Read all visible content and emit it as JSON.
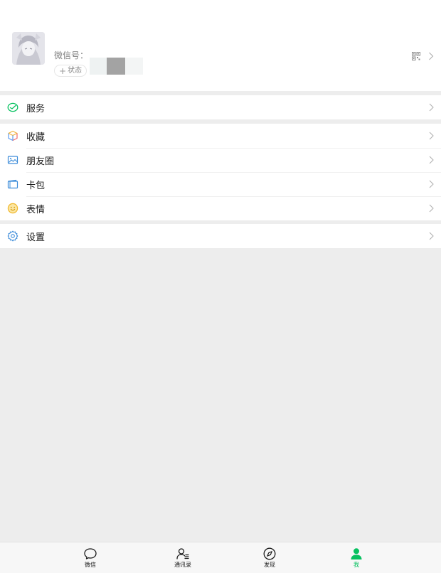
{
  "profile": {
    "wxid_label": "微信号：",
    "status_label": "状态",
    "status_plus": "+"
  },
  "menu": {
    "services": {
      "label": "服务",
      "icon": "services-icon"
    },
    "favorites": {
      "label": "收藏",
      "icon": "favorites-icon"
    },
    "moments": {
      "label": "朋友圈",
      "icon": "moments-icon"
    },
    "cards": {
      "label": "卡包",
      "icon": "card-wallet-icon"
    },
    "stickers": {
      "label": "表情",
      "icon": "sticker-icon"
    },
    "settings": {
      "label": "设置",
      "icon": "settings-icon"
    }
  },
  "tabs": [
    {
      "label": "微信",
      "icon": "chat-bubble-icon",
      "active": false
    },
    {
      "label": "通讯录",
      "icon": "contacts-icon",
      "active": false
    },
    {
      "label": "发现",
      "icon": "compass-icon",
      "active": false
    },
    {
      "label": "我",
      "icon": "person-icon",
      "active": true
    }
  ],
  "colors": {
    "accent": "#07c160",
    "background": "#ededed",
    "card": "#ffffff",
    "text": "#191919",
    "secondary_text": "#7f7f7f",
    "chevron": "#b2b2b2"
  }
}
